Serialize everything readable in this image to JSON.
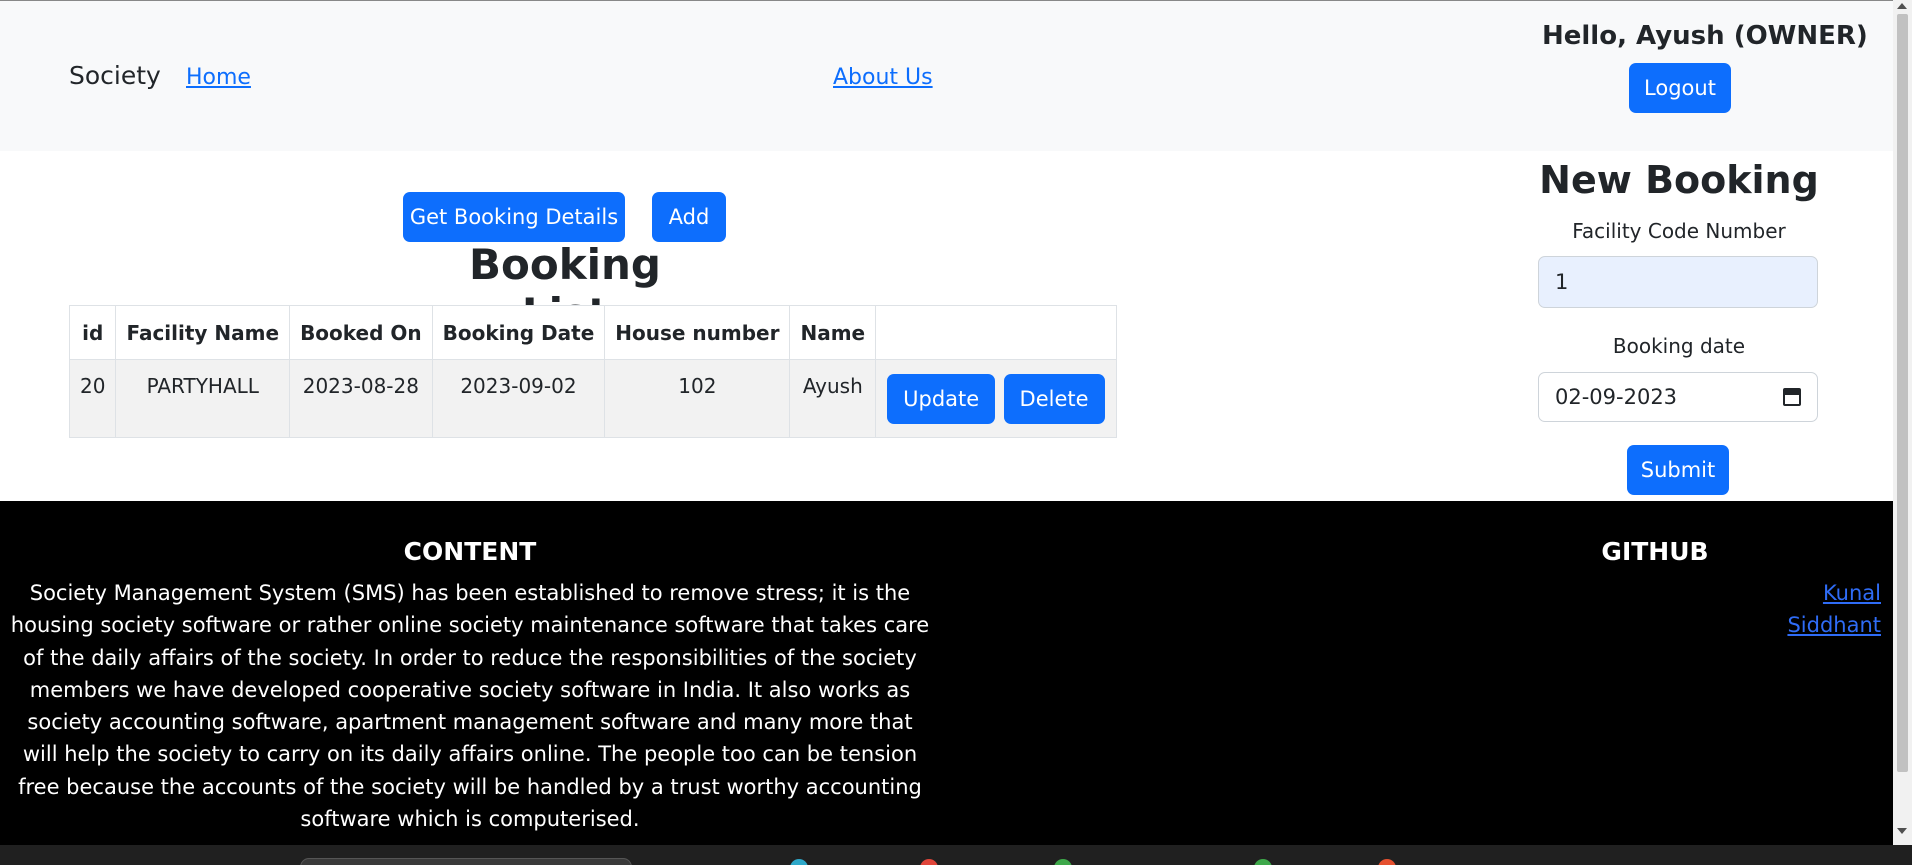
{
  "navbar": {
    "brand": "Society",
    "home_link": "Home",
    "about_link": "About Us",
    "greeting": "Hello, Ayush (OWNER)",
    "logout_label": "Logout"
  },
  "main": {
    "get_details_label": "Get Booking Details",
    "add_label": "Add",
    "list_title": "Booking List",
    "table": {
      "headers": [
        "id",
        "Facility Name",
        "Booked On",
        "Booking Date",
        "House number",
        "Name",
        ""
      ],
      "rows": [
        {
          "id": "20",
          "facility_name": "PARTYHALL",
          "booked_on": "2023-08-28",
          "booking_date": "2023-09-02",
          "house_number": "102",
          "name": "Ayush",
          "update_label": "Update",
          "delete_label": "Delete"
        }
      ]
    }
  },
  "booking_form": {
    "title": "New Booking",
    "facility_code_label": "Facility Code Number",
    "facility_code_value": "1",
    "booking_date_label": "Booking date",
    "booking_date_value": "02-09-2023",
    "submit_label": "Submit"
  },
  "footer": {
    "content_title": "CONTENT",
    "content_text": "Society Management System (SMS) has been established to remove stress; it is the housing society software or rather online society maintenance software that takes care of the daily affairs of the society. In order to reduce the responsibilities of the society members we have developed cooperative society software in India. It also works as society accounting software, apartment management software and many more that will help the society to carry on its daily affairs online. The people too can be tension free because the accounts of the society will be handled by a trust worthy accounting software which is computerised.",
    "github_title": "GITHUB",
    "github_links": [
      "Kunal",
      "Siddhant"
    ]
  },
  "colors": {
    "primary": "#0d6efd",
    "navbar_bg": "#f8f9fa",
    "footer_bg": "#000000",
    "autofill_bg": "#e8f0fe"
  }
}
